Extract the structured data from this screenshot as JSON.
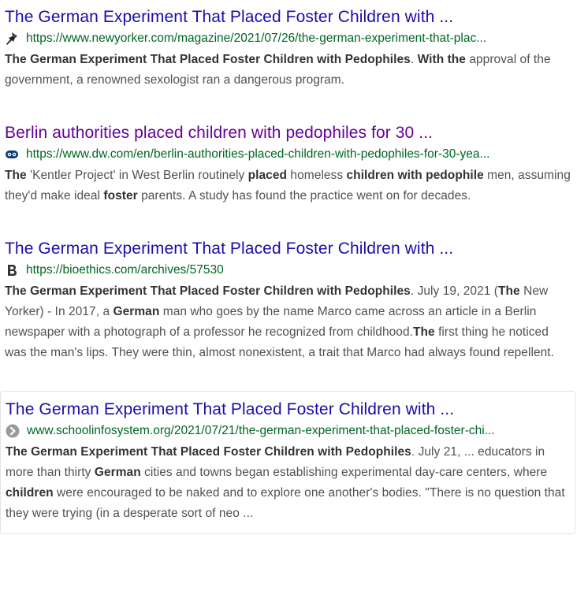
{
  "results": [
    {
      "title": "The German Experiment That Placed Foster Children with ...",
      "url": "https://www.newyorker.com/magazine/2021/07/26/the-german-experiment-that-plac...",
      "favicon": "newyorker-pin-icon",
      "visited": false,
      "snippet": [
        {
          "t": "The German Experiment That Placed Foster Children with Pedophiles",
          "b": true
        },
        {
          "t": ". ",
          "b": false
        },
        {
          "t": "With the",
          "b": true
        },
        {
          "t": " approval of the government, a renowned sexologist ran a dangerous program.",
          "b": false
        }
      ]
    },
    {
      "title": "Berlin authorities placed children with pedophiles for 30 ...",
      "url": "https://www.dw.com/en/berlin-authorities-placed-children-with-pedophiles-for-30-yea...",
      "favicon": "dw-logo-icon",
      "visited": true,
      "snippet": [
        {
          "t": "The",
          "b": true
        },
        {
          "t": " 'Kentler Project' in West Berlin routinely ",
          "b": false
        },
        {
          "t": "placed",
          "b": true
        },
        {
          "t": " homeless ",
          "b": false
        },
        {
          "t": "children with pedophile",
          "b": true
        },
        {
          "t": " men, assuming they'd make ideal ",
          "b": false
        },
        {
          "t": "foster",
          "b": true
        },
        {
          "t": " parents. A study has found the practice went on for decades.",
          "b": false
        }
      ]
    },
    {
      "title": "The German Experiment That Placed Foster Children with ...",
      "url": "https://bioethics.com/archives/57530",
      "favicon": "bioethics-b-icon",
      "visited": false,
      "snippet": [
        {
          "t": "The German Experiment That Placed Foster Children with Pedophiles",
          "b": true
        },
        {
          "t": ". July 19, 2021 (",
          "b": false
        },
        {
          "t": "The",
          "b": true
        },
        {
          "t": " New Yorker) - In 2017, a ",
          "b": false
        },
        {
          "t": "German",
          "b": true
        },
        {
          "t": " man who goes by the name Marco came across an article in a Berlin newspaper with a photograph of a professor he recognized from childhood.",
          "b": false
        },
        {
          "t": "The",
          "b": true
        },
        {
          "t": " first thing he noticed was the man's lips. They were thin, almost nonexistent, a trait that Marco had always found repellent.",
          "b": false
        }
      ]
    },
    {
      "title": "The German Experiment That Placed Foster Children with ...",
      "url": "www.schoolinfosystem.org/2021/07/21/the-german-experiment-that-placed-foster-chi...",
      "favicon": "generic-site-arrow-icon",
      "visited": false,
      "snippet": [
        {
          "t": "The German Experiment That Placed Foster Children with Pedophiles",
          "b": true
        },
        {
          "t": ". July 21, ... educators in more than thirty ",
          "b": false
        },
        {
          "t": "German",
          "b": true
        },
        {
          "t": " cities and towns began establishing experimental day-care centers, where ",
          "b": false
        },
        {
          "t": "children",
          "b": true
        },
        {
          "t": " were encouraged to be naked and to explore one another's bodies. \"There is no question that they were trying (in a desperate sort of neo ...",
          "b": false
        }
      ]
    }
  ],
  "colors": {
    "title": "#1a0dab",
    "visited_title": "#660099",
    "url": "#006621",
    "snippet": "#4d5156"
  }
}
